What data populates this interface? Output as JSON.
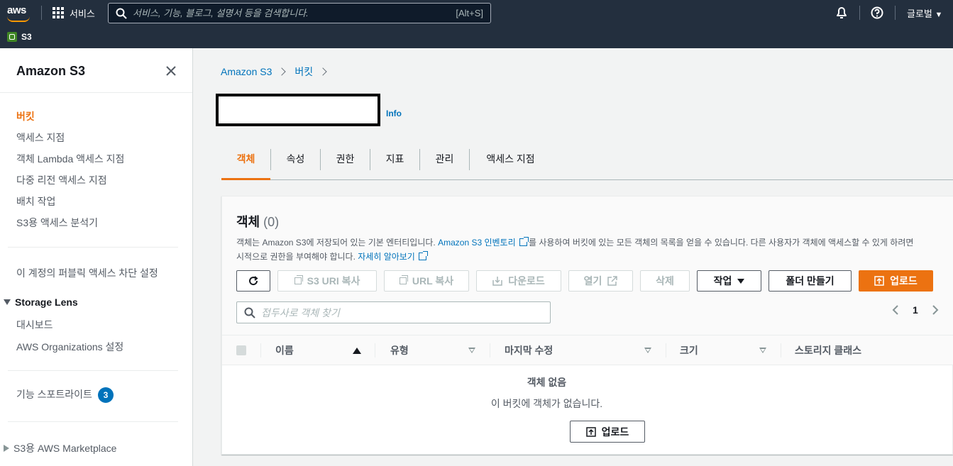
{
  "topnav": {
    "logo_text": "aws",
    "services_label": "서비스",
    "search_placeholder": "서비스, 기능, 블로그, 설명서 등을 검색합니다.",
    "search_shortcut": "[Alt+S]",
    "region_label": "글로벌",
    "service_crumb": "S3"
  },
  "sidebar": {
    "title": "Amazon S3",
    "items": [
      "버킷",
      "액세스 지점",
      "객체 Lambda 액세스 지점",
      "다중 리전 액세스 지점",
      "배치 작업",
      "S3용 액세스 분석기"
    ],
    "public_access": "이 계정의 퍼블릭 액세스 차단 설정",
    "storage_lens": {
      "title": "Storage Lens",
      "items": [
        "대시보드",
        "AWS Organizations 설정"
      ]
    },
    "feature_spotlight": "기능 스포트라이트",
    "feature_count": "3",
    "marketplace": "S3용 AWS Marketplace"
  },
  "breadcrumb": [
    "Amazon S3",
    "버킷"
  ],
  "info_label": "Info",
  "tabs": [
    "객체",
    "속성",
    "권한",
    "지표",
    "관리",
    "액세스 지점"
  ],
  "objects": {
    "title": "객체",
    "count": "(0)",
    "desc_1": "객체는 Amazon S3에 저장되어 있는 기본 엔터티입니다. ",
    "inventory_link": "Amazon S3 인벤토리",
    "desc_2": "를 사용하여 버킷에 있는 모든 객체의 목록을 얻을 수 있습니다. 다른 사용자가 객체에 액세스할 수 있게 하려면 ",
    "desc_3": "시적으로 권한을 부여해야 합니다. ",
    "learn_more": "자세히 알아보기",
    "buttons": {
      "copy_s3_uri": "S3 URI 복사",
      "copy_url": "URL 복사",
      "download": "다운로드",
      "open": "열기",
      "delete": "삭제",
      "actions": "작업",
      "create_folder": "폴더 만들기",
      "upload": "업로드"
    },
    "filter_placeholder": "접두사로 객체 찾기",
    "page": "1",
    "columns": [
      "이름",
      "유형",
      "마지막 수정",
      "크기",
      "스토리지 클래스"
    ],
    "empty_title": "객체 없음",
    "empty_desc": "이 버킷에 객체가 없습니다.",
    "empty_upload": "업로드"
  },
  "colors": {
    "nav_bg": "#232f3e",
    "accent": "#ec7211",
    "link": "#0073bb"
  }
}
